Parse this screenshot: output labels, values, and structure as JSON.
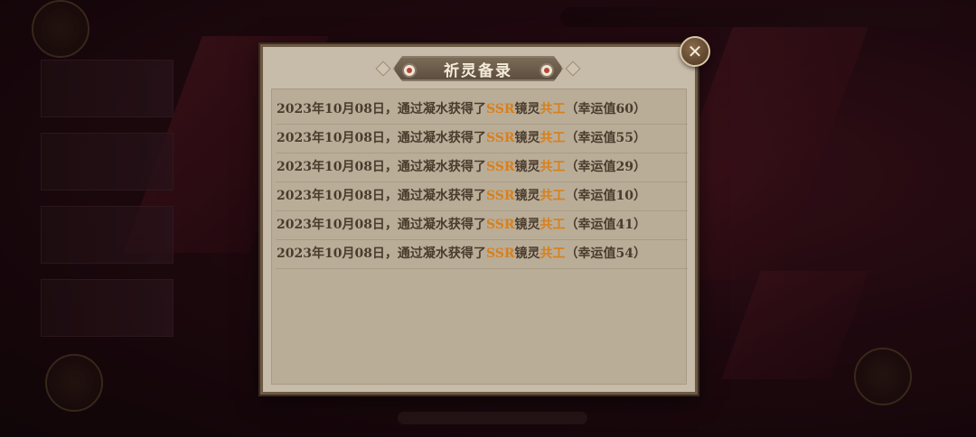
{
  "dialog": {
    "title": "祈灵备录",
    "close_icon": "close-icon"
  },
  "records": [
    {
      "prefix": "2023年10月08日，通过凝水获得了",
      "rarity": "SSR",
      "middle": "镜灵",
      "name": "共工",
      "suffix": "（幸运值60）"
    },
    {
      "prefix": "2023年10月08日，通过凝水获得了",
      "rarity": "SSR",
      "middle": "镜灵",
      "name": "共工",
      "suffix": "（幸运值55）"
    },
    {
      "prefix": "2023年10月08日，通过凝水获得了",
      "rarity": "SSR",
      "middle": "镜灵",
      "name": "共工",
      "suffix": "（幸运值29）"
    },
    {
      "prefix": "2023年10月08日，通过凝水获得了",
      "rarity": "SSR",
      "middle": "镜灵",
      "name": "共工",
      "suffix": "（幸运值10）"
    },
    {
      "prefix": "2023年10月08日，通过凝水获得了",
      "rarity": "SSR",
      "middle": "镜灵",
      "name": "共工",
      "suffix": "（幸运值41）"
    },
    {
      "prefix": "2023年10月08日，通过凝水获得了",
      "rarity": "SSR",
      "middle": "镜灵",
      "name": "共工",
      "suffix": "（幸运值54）"
    }
  ],
  "colors": {
    "highlight": "#d8801c",
    "text": "#4a3b2c",
    "panel": "#c7bca9"
  }
}
